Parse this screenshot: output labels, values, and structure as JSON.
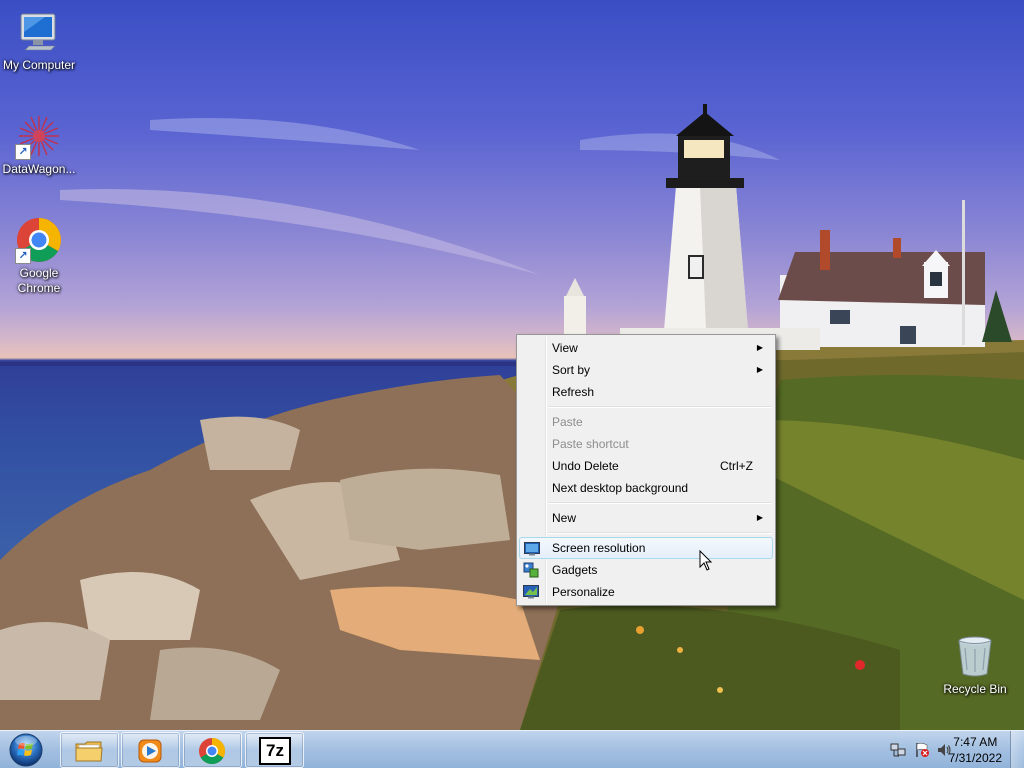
{
  "desktop": {
    "icons": [
      {
        "label": "My Computer",
        "icon": "computer-icon"
      },
      {
        "label": "DataWagon...",
        "icon": "datawagon-icon"
      },
      {
        "label": "Google Chrome",
        "icon": "chrome-icon"
      },
      {
        "label": "Recycle Bin",
        "icon": "recycle-bin-icon"
      }
    ]
  },
  "context_menu": {
    "items": [
      {
        "label": "View",
        "submenu": true
      },
      {
        "label": "Sort by",
        "submenu": true
      },
      {
        "label": "Refresh"
      },
      {
        "label": "Paste",
        "disabled": true
      },
      {
        "label": "Paste shortcut",
        "disabled": true
      },
      {
        "label": "Undo Delete",
        "shortcut": "Ctrl+Z"
      },
      {
        "label": "Next desktop background"
      },
      {
        "label": "New",
        "submenu": true
      },
      {
        "label": "Screen resolution",
        "icon": "screen-resolution-icon",
        "highlighted": true
      },
      {
        "label": "Gadgets",
        "icon": "gadgets-icon"
      },
      {
        "label": "Personalize",
        "icon": "personalize-icon"
      }
    ]
  },
  "taskbar": {
    "pinned": [
      {
        "name": "Windows Explorer",
        "icon": "folder-icon"
      },
      {
        "name": "Windows Media Player",
        "icon": "media-player-icon"
      },
      {
        "name": "Google Chrome",
        "icon": "chrome-icon"
      },
      {
        "name": "7-Zip",
        "icon": "7zip-icon",
        "text": "7z"
      }
    ],
    "tray": {
      "icons": [
        "network-icon",
        "action-center-flag-icon",
        "volume-icon"
      ],
      "time": "7:47 AM",
      "date": "7/31/2022"
    }
  },
  "colors": {
    "menu_highlight_border": "#a8d8eb",
    "taskbar": "#a0bee1",
    "disabled_text": "#8d8d8d"
  }
}
